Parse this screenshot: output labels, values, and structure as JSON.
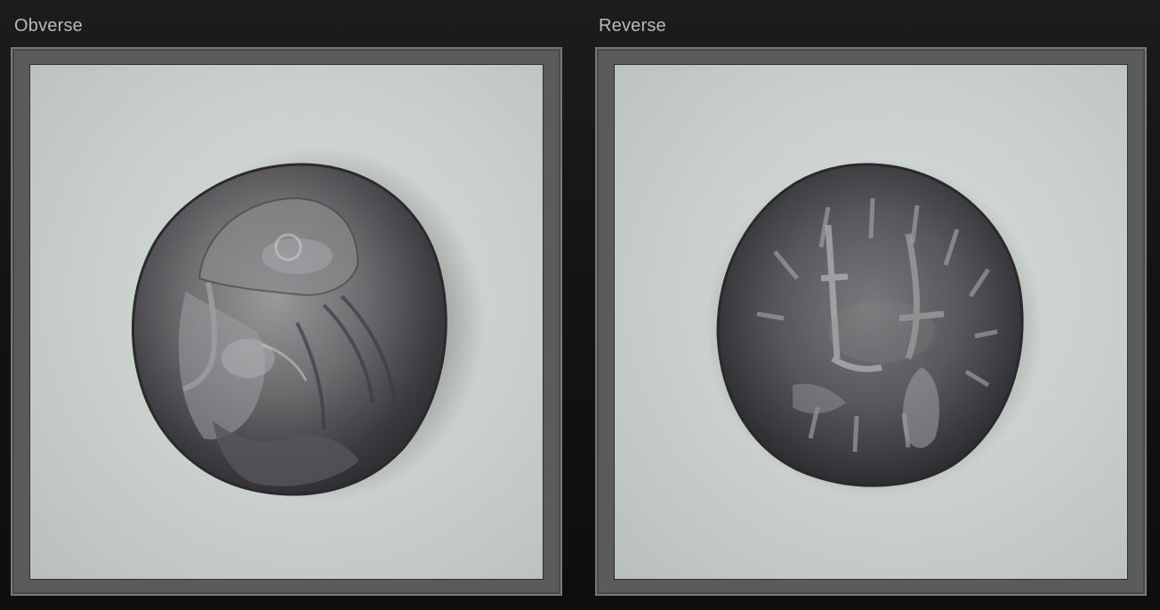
{
  "panels": {
    "obverse": {
      "label": "Obverse",
      "image": "coin-obverse-portrait"
    },
    "reverse": {
      "label": "Reverse",
      "image": "coin-reverse-figures"
    }
  },
  "colors": {
    "background": "#151515",
    "frame": "#5b5b5b",
    "photo_background": "#cdd3cf",
    "coin_silver": "#6e6e6e",
    "label_text": "#b9b9b9"
  }
}
